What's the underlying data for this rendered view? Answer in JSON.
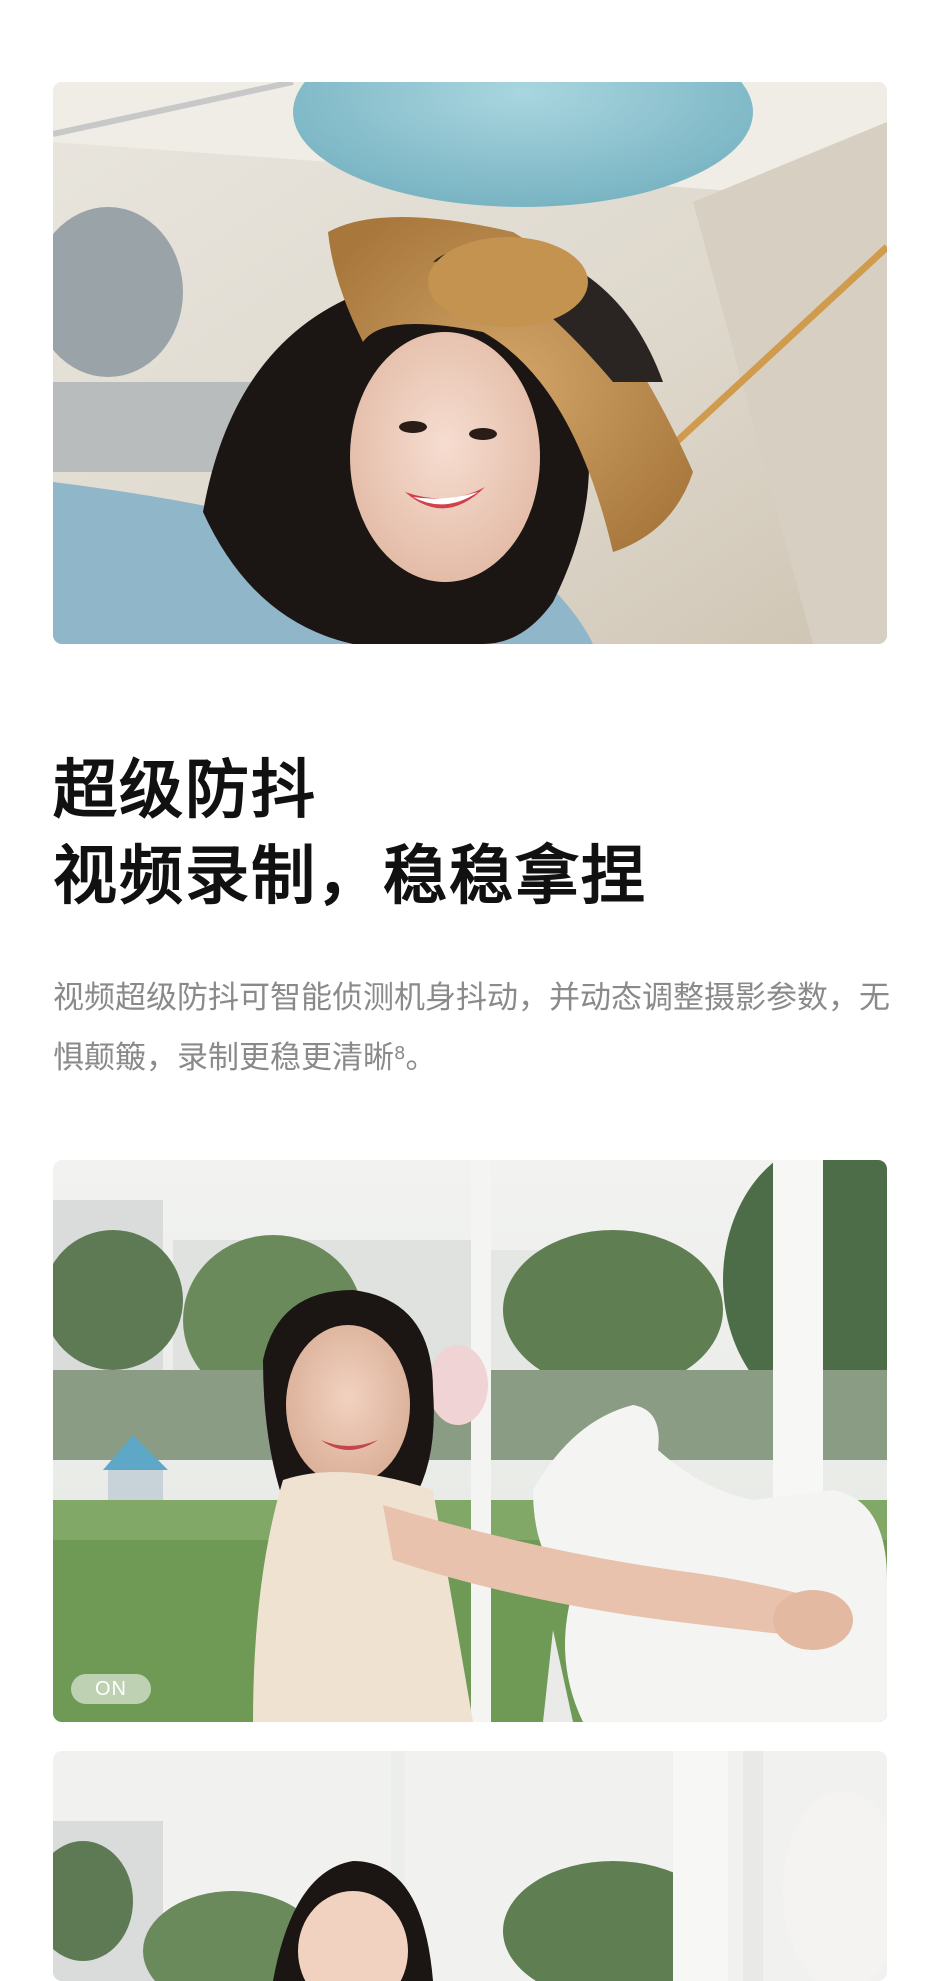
{
  "feature": {
    "title_line1": "超级防抖",
    "title_line2": "视频录制，稳稳拿捏",
    "description": "视频超级防抖可智能侦测机身抖动，并动态调整摄影参数，无惧颠簸，录制更稳更清晰",
    "footnote": "8",
    "description_end": "。"
  },
  "comparison": {
    "on_badge": "ON"
  },
  "colors": {
    "text": "#111111",
    "muted_text": "#8a8a8a",
    "page_bg": "#ffffff"
  }
}
